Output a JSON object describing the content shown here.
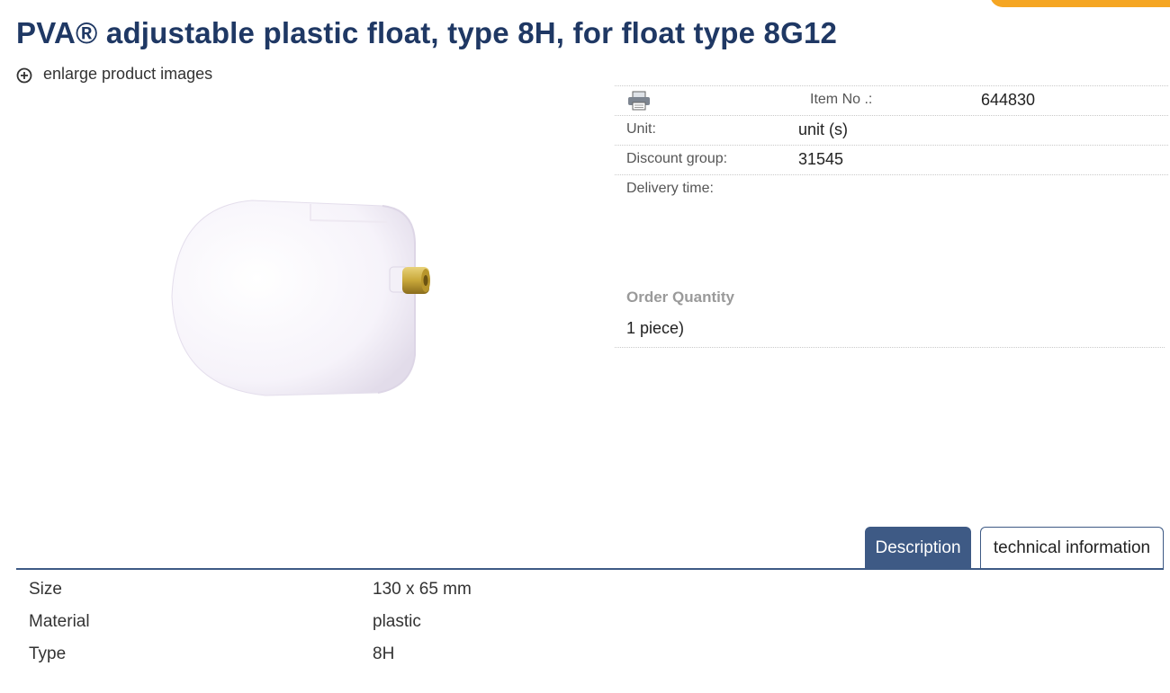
{
  "product": {
    "title": "PVA® adjustable plastic float, type 8H, for float type 8G12",
    "enlarge_label": "enlarge product images",
    "image_alt": "white plastic float with brass fitting"
  },
  "details": {
    "item_no_label": "Item No .:",
    "item_no_value": "644830",
    "unit_label": "Unit:",
    "unit_value": "unit (s)",
    "discount_label": "Discount group:",
    "discount_value": "31545",
    "delivery_label": "Delivery time:",
    "order_qty_label": "Order Quantity",
    "order_qty_value": "1 piece)"
  },
  "tabs": [
    {
      "label": "Description",
      "active": true
    },
    {
      "label": "technical information",
      "active": false
    }
  ],
  "specs": [
    {
      "name": "Size",
      "value": "130 x 65 mm"
    },
    {
      "name": "Material",
      "value": "plastic"
    },
    {
      "name": "Type",
      "value": "8H"
    }
  ],
  "colors": {
    "title": "#1f3864",
    "tab_active": "#3e5a85",
    "accent_orange": "#f5a623"
  },
  "icons": {
    "enlarge": "plus-circle-icon",
    "print": "printer-icon"
  }
}
